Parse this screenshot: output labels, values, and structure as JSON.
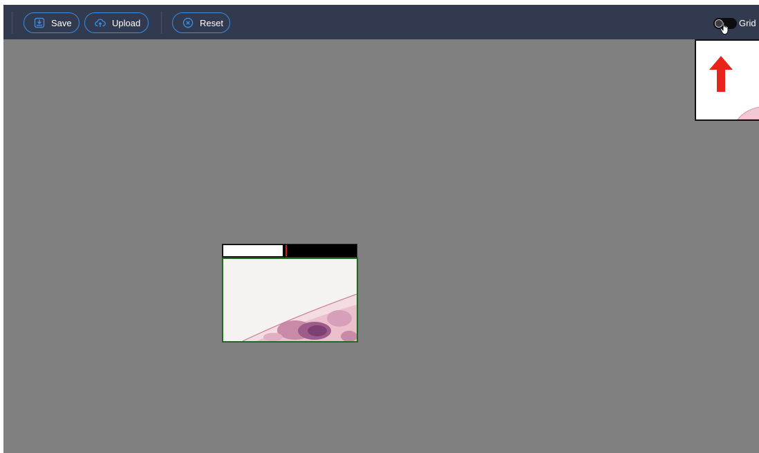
{
  "toolbar": {
    "save": {
      "label": "Save",
      "icon": "save-icon"
    },
    "upload": {
      "label": "Upload",
      "icon": "cloud-upload-icon"
    },
    "reset": {
      "label": "Reset",
      "icon": "close-circle-icon"
    },
    "grid": {
      "label": "Grid",
      "enabled": false
    }
  },
  "viewer": {
    "navigator": {
      "direction": "up",
      "arrow_color": "#e8241a"
    },
    "progress": {
      "fraction": 0.45
    }
  },
  "colors": {
    "toolbar_bg": "#313a4f",
    "accent": "#3a8ee6",
    "canvas_bg": "#808080",
    "tile_border": "#1e6b1e",
    "marker": "#d22020"
  }
}
